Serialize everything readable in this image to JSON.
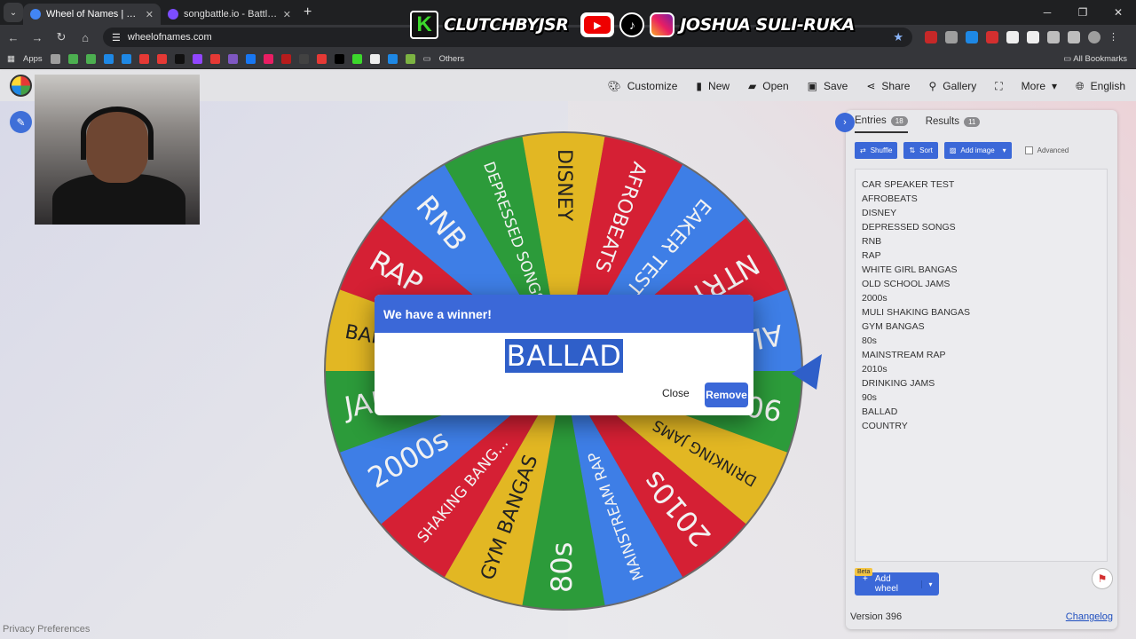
{
  "browser": {
    "tabs": [
      {
        "title": "Wheel of Names | Random nam",
        "active": true,
        "color": "#4285f4"
      },
      {
        "title": "songbattle.io - Battle Songs ag",
        "active": false,
        "color": "#7c4dff"
      }
    ],
    "url": "wheelofnames.com",
    "bookmarks": {
      "apps_label": "Apps",
      "others_label": "Others",
      "all_label": "All Bookmarks"
    }
  },
  "banner": {
    "left_handle": "CLUTCHBYJSR",
    "right_handle": "JOSHUA SULI-RUKA"
  },
  "toolbar": {
    "customize": "Customize",
    "new": "New",
    "open": "Open",
    "save": "Save",
    "share": "Share",
    "gallery": "Gallery",
    "more": "More",
    "language": "English"
  },
  "wheel": {
    "colors": [
      "#3e7ee6",
      "#2c9b3a",
      "#e2b723",
      "#d52034"
    ],
    "segments": [
      "DISNEY",
      "AFROBEATS",
      "CAR SPEAKER TEST",
      "COUNTRY",
      "BALLAD",
      "90s",
      "DRINKING JAMS",
      "2010s",
      "MAINSTREAM RAP",
      "80s",
      "GYM BANGAS",
      "MULI SHAKING BANGAS",
      "2000s",
      "OLD SCHOOL JAMS",
      "WHITE GIRL BANGAS",
      "RAP",
      "RNB",
      "DEPRESSED SONGS"
    ],
    "segment_labels": [
      "DISNEY",
      "AFROBEATS",
      "EAKER TEST",
      "NTRY",
      "ALLAD",
      "90s",
      "DRINKING JAMS",
      "2010s",
      "MAINSTREAM RAP",
      "80s",
      "GYM BANGAS",
      "SHAKING BANG...",
      "2000s",
      "JAMS",
      "BANGAS",
      "RAP",
      "RNB",
      "DEPRESSED SONGS"
    ],
    "segment_colors": [
      "#e2b723",
      "#d52034",
      "#3e7ee6",
      "#d52034",
      "#3e7ee6",
      "#2c9b3a",
      "#e2b723",
      "#d52034",
      "#3e7ee6",
      "#2c9b3a",
      "#e2b723",
      "#d52034",
      "#3e7ee6",
      "#2c9b3a",
      "#e2b723",
      "#d52034",
      "#3e7ee6",
      "#2c9b3a"
    ]
  },
  "dialog": {
    "title": "We have a winner!",
    "winner": "BALLAD",
    "close_label": "Close",
    "remove_label": "Remove"
  },
  "panel": {
    "entries_tab": "Entries",
    "entries_count": "18",
    "results_tab": "Results",
    "results_count": "11",
    "shuffle": "Shuffle",
    "sort": "Sort",
    "add_image": "Add image",
    "advanced": "Advanced",
    "entries": [
      "CAR SPEAKER TEST",
      "AFROBEATS",
      "DISNEY",
      "DEPRESSED SONGS",
      "RNB",
      "RAP",
      "WHITE GIRL BANGAS",
      "OLD SCHOOL JAMS",
      "2000s",
      "MULI SHAKING BANGAS",
      "GYM BANGAS",
      "80s",
      "MAINSTREAM RAP",
      "2010s",
      "DRINKING JAMS",
      "90s",
      "BALLAD",
      "COUNTRY"
    ],
    "beta": "Beta",
    "add_wheel": "Add wheel",
    "version": "Version 396",
    "changelog": "Changelog"
  },
  "privacy": "Privacy Preferences",
  "colors": {
    "accent": "#3b68d8"
  }
}
